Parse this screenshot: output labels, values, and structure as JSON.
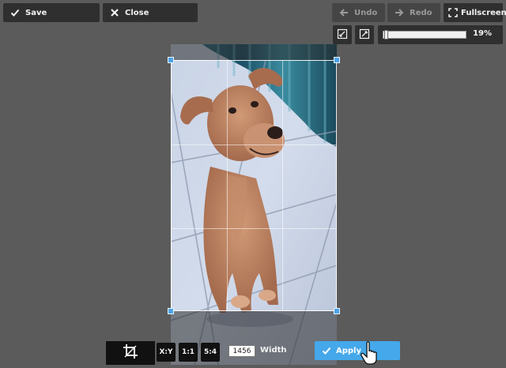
{
  "toolbar": {
    "save_label": "Save",
    "close_label": "Close",
    "undo_label": "Undo",
    "redo_label": "Redo",
    "fullscreen_label": "Fullscreen"
  },
  "zoom": {
    "value_label": "19%",
    "value": 0.19
  },
  "crop": {
    "ratio_free_label": "X:Y",
    "ratio_square_label": "1:1",
    "ratio_54_label": "5:4",
    "width_value": "1456",
    "width_label": "Width",
    "apply_label": "Apply"
  },
  "icons": {
    "save": "check-icon",
    "close": "x-icon",
    "undo": "arrow-left-icon",
    "redo": "arrow-right-icon",
    "fullscreen": "expand-icon",
    "crop": "crop-icon",
    "cursor": "hand-pointer-icon"
  },
  "colors": {
    "accent": "#45a8ea",
    "handle": "#4da3e8",
    "toolbar": "#2f2f2f",
    "background": "#5b5b5b"
  }
}
